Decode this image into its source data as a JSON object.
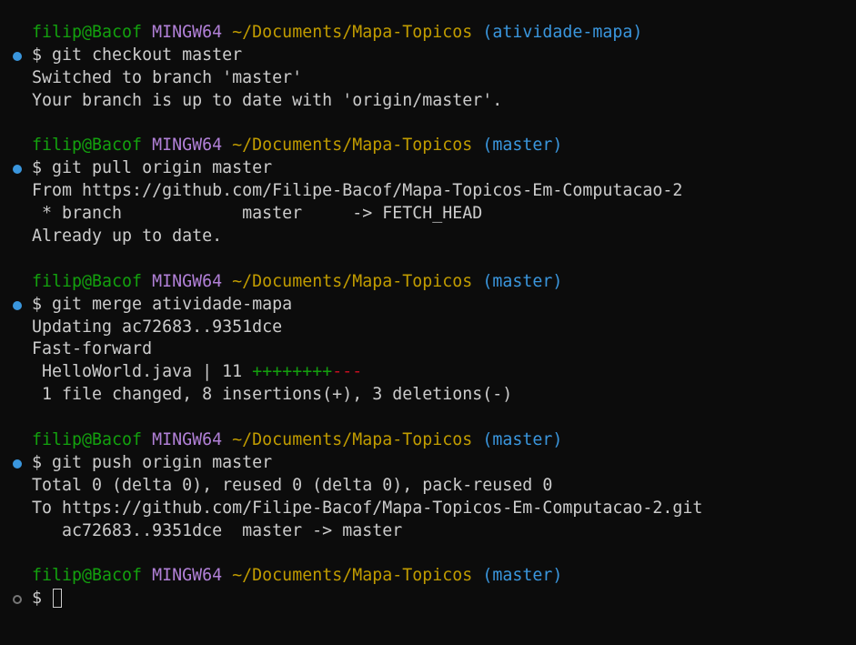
{
  "prompt": {
    "user_host": "filip@Bacof",
    "shell": "MINGW64",
    "path": "~/Documents/Mapa-Topicos"
  },
  "blocks": [
    {
      "branch": "(atividade-mapa)",
      "command": "$ git checkout master",
      "output": [
        "Switched to branch 'master'",
        "Your branch is up to date with 'origin/master'."
      ]
    },
    {
      "branch": "(master)",
      "command": "$ git pull origin master",
      "output": [
        "From https://github.com/Filipe-Bacof/Mapa-Topicos-Em-Computacao-2",
        " * branch            master     -> FETCH_HEAD",
        "Already up to date."
      ]
    },
    {
      "branch": "(master)",
      "command": "$ git merge atividade-mapa",
      "output": [
        "Updating ac72683..9351dce",
        "Fast-forward"
      ],
      "diffstat": {
        "file_line": " HelloWorld.java | 11 ",
        "plus": "++++++++",
        "minus": "---",
        "summary": " 1 file changed, 8 insertions(+), 3 deletions(-)"
      }
    },
    {
      "branch": "(master)",
      "command": "$ git push origin master",
      "output": [
        "Total 0 (delta 0), reused 0 (delta 0), pack-reused 0",
        "To https://github.com/Filipe-Bacof/Mapa-Topicos-Em-Computacao-2.git",
        "   ac72683..9351dce  master -> master"
      ]
    },
    {
      "branch": "(master)",
      "command": "$ "
    }
  ],
  "colors": {
    "background": "#0c0c0c",
    "text": "#cccccc",
    "user_host": "#13a10e",
    "shell": "#b180d7",
    "path": "#c19c00",
    "branch": "#3a96dd",
    "status_dot_done": "#3a96dd",
    "status_dot_pending": "#767676",
    "diff_plus": "#13a10e",
    "diff_minus": "#c50f1f"
  },
  "icons": {
    "completed": "filled-circle-icon",
    "pending": "hollow-circle-icon"
  }
}
